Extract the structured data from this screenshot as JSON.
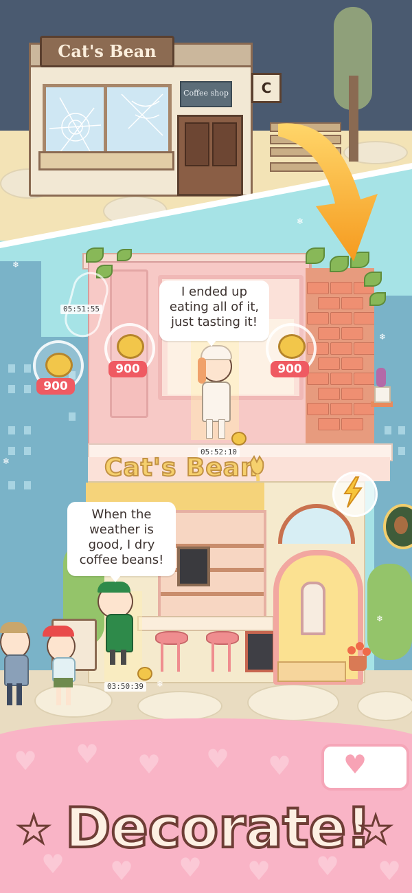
{
  "top_panel": {
    "shop_sign": "Cat's Bean",
    "plate_text": "Coffee shop",
    "corner_sign": "C"
  },
  "main": {
    "sign_text": "Cat's Bean",
    "bubble_upper": [
      "I ended up",
      "eating all of it,",
      "just tasting it!"
    ],
    "bubble_lower": [
      "When the",
      "weather is",
      "good, I dry",
      "coffee beans!"
    ],
    "coins": [
      {
        "price": "900"
      },
      {
        "price": "900"
      },
      {
        "price": "900"
      }
    ],
    "timers": {
      "left_pillar": "05:51:55",
      "upper_floor": "05:52:10",
      "barista": "03:50:39"
    }
  },
  "banner": {
    "title": "Decorate!"
  },
  "colors": {
    "banner_pink": "#f9b4c6",
    "price_red": "#ef5a62",
    "coin_gold": "#f2c64a",
    "arrow_orange": "#f59a1e"
  },
  "icons": [
    "coin-icon",
    "lightning-icon",
    "coffee-bean-icon",
    "star-icon",
    "heart-icon",
    "snowflake-icon"
  ]
}
